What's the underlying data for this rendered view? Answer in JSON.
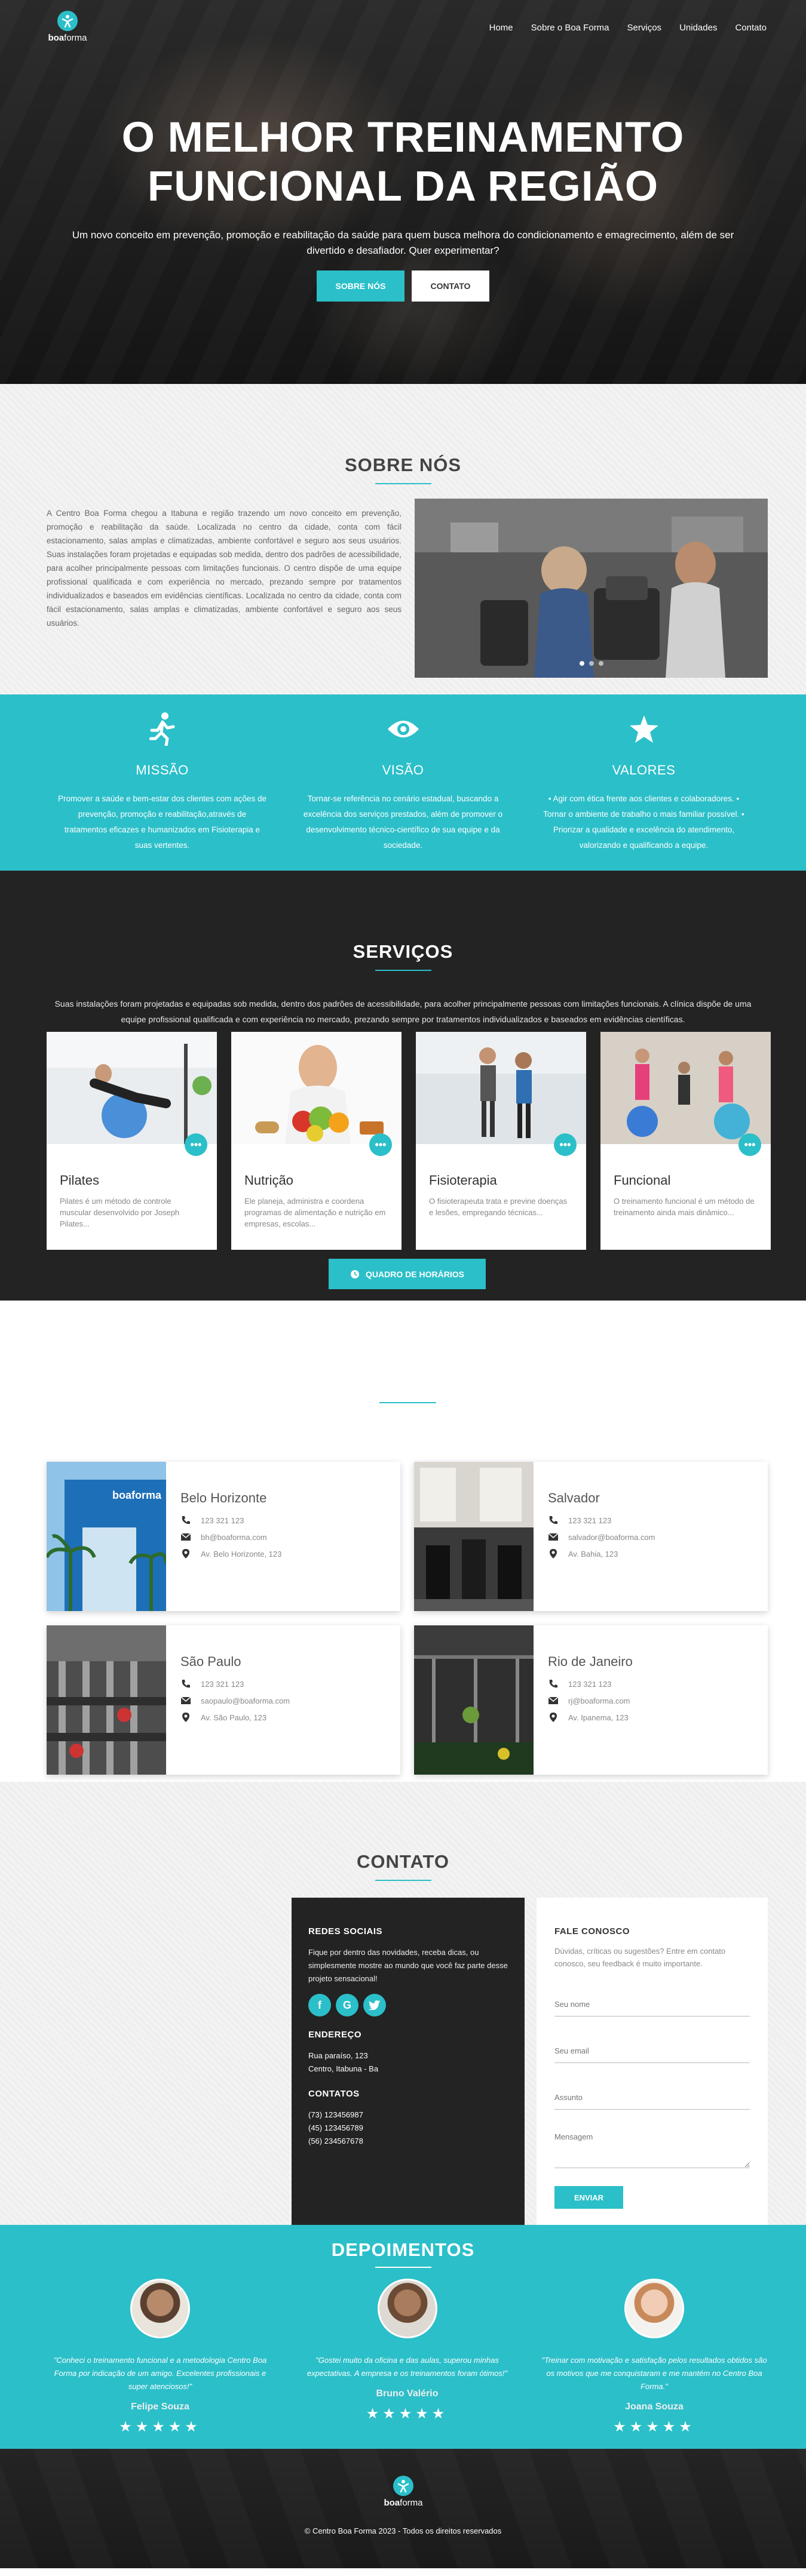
{
  "brand": {
    "logo_bold": "boa",
    "logo_light": "forma"
  },
  "nav": [
    "Home",
    "Sobre o Boa Forma",
    "Serviços",
    "Unidades",
    "Contato"
  ],
  "hero": {
    "title_line1": "O MELHOR TREINAMENTO",
    "title_line2": "FUNCIONAL DA REGIÃO",
    "subtitle": "Um novo conceito em prevenção, promoção e reabilitação da saúde para quem busca melhora do condicionamento e emagrecimento, além de ser divertido e desafiador. Quer experimentar?",
    "btn_about": "SOBRE NÓS",
    "btn_contact": "CONTATO"
  },
  "about": {
    "title": "SOBRE NÓS",
    "text": "A Centro Boa Forma chegou a Itabuna e região trazendo um novo conceito em prevenção, promoção e reabilitação da saúde. Localizada no centro da cidade, conta com fácil estacionamento, salas amplas e climatizadas, ambiente confortável e seguro aos seus usuários. Suas instalações foram projetadas e equipadas sob medida, dentro dos padrões de acessibilidade, para acolher principalmente pessoas com limitações funcionais. O centro dispõe de uma equipe profissional qualificada e com experiência no mercado, prezando sempre por tratamentos individualizados e baseados em evidências científicas. Localizada no centro da cidade, conta com fácil estacionamento, salas amplas e climatizadas, ambiente confortável e seguro aos seus usuários."
  },
  "mvv": [
    {
      "title": "MISSÃO",
      "icon": "runner-icon",
      "text": "Promover a saúde e bem-estar dos clientes com ações de prevenção, promoção e reabilitação,através de tratamentos eficazes e humanizados em Fisioterapia e suas vertentes."
    },
    {
      "title": "VISÃO",
      "icon": "eye-icon",
      "text": "Tornar-se referência no cenário estadual, buscando a excelência dos serviços prestados, além de promover o desenvolvimento técnico-científico de sua equipe e da sociedade."
    },
    {
      "title": "VALORES",
      "icon": "star-icon",
      "text": "• Agir com ética frente aos clientes e colaboradores. • Tornar o ambiente de trabalho o mais familiar possível. • Priorizar a qualidade e excelência do atendimento, valorizando e qualificando a equipe."
    }
  ],
  "services": {
    "title": "SERVIÇOS",
    "intro": "Suas instalações foram projetadas e equipadas sob medida, dentro dos padrões de acessibilidade, para acolher principalmente pessoas com limitações funcionais. A clínica dispõe de uma equipe profissional qualificada e com experiência no mercado, prezando sempre por tratamentos individualizados e baseados em evidências científicas.",
    "cards": [
      {
        "title": "Pilates",
        "text": "Pilates é um método de controle muscular desenvolvido por Joseph Pilates..."
      },
      {
        "title": "Nutrição",
        "text": "Ele planeja, administra e coordena programas de alimentação e nutrição em empresas, escolas..."
      },
      {
        "title": "Fisioterapia",
        "text": "O fisioterapeuta trata e previne doenças e lesões, empregando técnicas..."
      },
      {
        "title": "Funcional",
        "text": "O treinamento funcional é um método de treinamento ainda mais dinâmico..."
      }
    ],
    "more": "•••",
    "schedule_btn": "QUADRO DE HORÁRIOS"
  },
  "units": [
    {
      "city": "Belo Horizonte",
      "phone": "123 321 123",
      "email": "bh@boaforma.com",
      "address": "Av. Belo Horizonte, 123"
    },
    {
      "city": "Salvador",
      "phone": "123 321 123",
      "email": "salvador@boaforma.com",
      "address": "Av. Bahia, 123"
    },
    {
      "city": "São Paulo",
      "phone": "123 321 123",
      "email": "saopaulo@boaforma.com",
      "address": "Av. São Paulo, 123"
    },
    {
      "city": "Rio de Janeiro",
      "phone": "123 321 123",
      "email": "rj@boaforma.com",
      "address": "Av. Ipanema, 123"
    }
  ],
  "contact": {
    "title": "CONTATO",
    "social_title": "REDES SOCIAIS",
    "social_text": "Fique por dentro das novidades, receba dicas, ou simplesmente mostre ao mundo que você faz parte desse projeto sensacional!",
    "address_title": "ENDEREÇO",
    "address_line1": "Rua paraíso, 123",
    "address_line2": "Centro, Itabuna - Ba",
    "contacts_title": "CONTATOS",
    "phones": [
      "(73) 123456987",
      "(45) 123456789",
      "(56) 234567678"
    ],
    "form_title": "FALE CONOSCO",
    "form_text": "Dúvidas, críticas ou sugestões? Entre em contato conosco, seu feedback é muito importante.",
    "ph_name": "Seu nome",
    "ph_email": "Seu email",
    "ph_subject": "Assunto",
    "ph_message": "Mensagem",
    "send": "ENVIAR"
  },
  "testimonials": {
    "title": "DEPOIMENTOS",
    "items": [
      {
        "quote": "\"Conheci o treinamento funcional e a metodologia Centro Boa Forma por indicação de um amigo. Excelentes profissionais e super atenciosos!\"",
        "name": "Felipe Souza"
      },
      {
        "quote": "\"Gostei muito da oficina e das aulas, superou minhas expectativas. A empresa e os treinamentos foram ótimos!\"",
        "name": "Bruno Valério"
      },
      {
        "quote": "\"Treinar com motivação e satisfação pelos resultados obtidos são os motivos que me conquistaram e me mantém no Centro Boa Forma.\"",
        "name": "Joana Souza"
      }
    ],
    "stars": "★★★★★"
  },
  "footer": {
    "copyright": "© Centro Boa Forma 2023 - Todos os direitos reservados"
  }
}
